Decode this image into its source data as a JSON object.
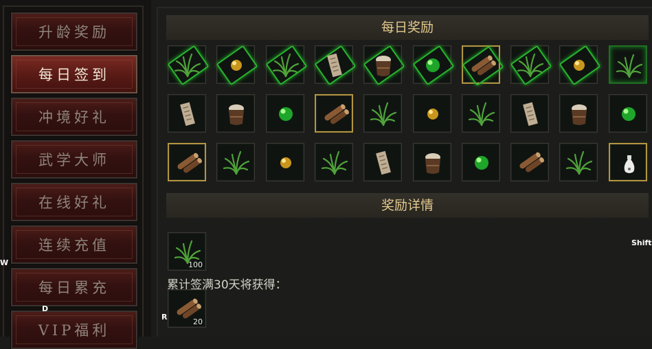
{
  "menu": {
    "items": [
      {
        "label": "升龄奖励",
        "active": false
      },
      {
        "label": "每日签到",
        "active": true
      },
      {
        "label": "冲境好礼",
        "active": false
      },
      {
        "label": "武学大师",
        "active": false
      },
      {
        "label": "在线好礼",
        "active": false
      },
      {
        "label": "连续充值",
        "active": false
      },
      {
        "label": "每日累充",
        "active": false
      },
      {
        "label": "VIP福利",
        "active": false
      }
    ]
  },
  "daily": {
    "title": "每日奖励",
    "rows": [
      [
        "grass-ticket",
        "gold-orb-ticket",
        "grass-ticket",
        "scroll-ticket",
        "jar-ticket",
        "green-orb-ticket",
        "logs-ticket",
        "grass-ticket",
        "gold-orb-ticket",
        "grass-framed"
      ],
      [
        "scroll",
        "jar",
        "green-orb",
        "logs",
        "grass",
        "gold-orb",
        "grass",
        "scroll",
        "jar",
        "green-orb"
      ],
      [
        "logs",
        "grass",
        "gold-orb",
        "grass",
        "scroll",
        "jar",
        "green-orb",
        "logs",
        "grass",
        "vase"
      ]
    ],
    "highlighted": [
      [
        0,
        6
      ],
      [
        1,
        3
      ],
      [
        2,
        0
      ],
      [
        2,
        9
      ]
    ]
  },
  "details": {
    "title": "奖励详情",
    "reward_qty": "100",
    "cumulative_text": "累计签满30天将获得：",
    "cumulative_qty": "20"
  },
  "keys": {
    "w": "W",
    "d": "D",
    "r": "R",
    "shift": "Shift"
  },
  "colors": {
    "accent_gold": "#e2c98e",
    "active_red": "#6a2219",
    "ticket_green": "#28b52f"
  }
}
